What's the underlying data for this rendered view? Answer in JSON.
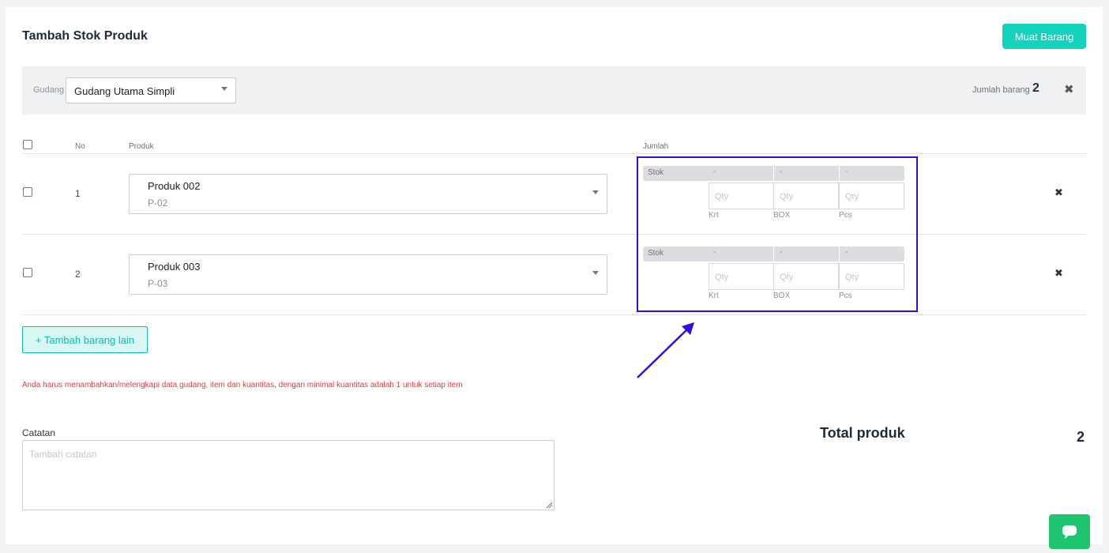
{
  "header": {
    "title": "Tambah Stok Produk",
    "load_button": "Muat Barang"
  },
  "filter": {
    "warehouse_label": "Gudang",
    "warehouse_value": "Gudang Utama Simpli",
    "count_label": "Jumlah barang",
    "count_value": "2"
  },
  "table": {
    "headers": {
      "no": "No",
      "product": "Produk",
      "quantity": "Jumlah"
    },
    "rows": [
      {
        "no": "1",
        "product_name": "Produk 002",
        "product_code": "P-02",
        "stock_label": "Stok",
        "stock_values": [
          "-",
          "-",
          "-"
        ],
        "qty_placeholder": "Qty",
        "units": [
          "Krt",
          "BOX",
          "Pcs"
        ]
      },
      {
        "no": "2",
        "product_name": "Produk 003",
        "product_code": "P-03",
        "stock_label": "Stok",
        "stock_values": [
          "-",
          "-",
          "-"
        ],
        "qty_placeholder": "Qty",
        "units": [
          "Krt",
          "BOX",
          "Pcs"
        ]
      }
    ]
  },
  "add_button": "+ Tambah barang lain",
  "error_message": "Anda harus menambahkan/melengkapi data gudang, item dan kuantitas, dengan minimal kuantitas adalah 1 untuk setiap item",
  "notes": {
    "label": "Catatan",
    "placeholder": "Tambah catatan"
  },
  "total": {
    "label": "Total produk",
    "value": "2"
  },
  "colors": {
    "accent": "#13d3bf",
    "highlight": "#2b10e0",
    "error": "#e53935",
    "chat": "#1ec46e"
  }
}
